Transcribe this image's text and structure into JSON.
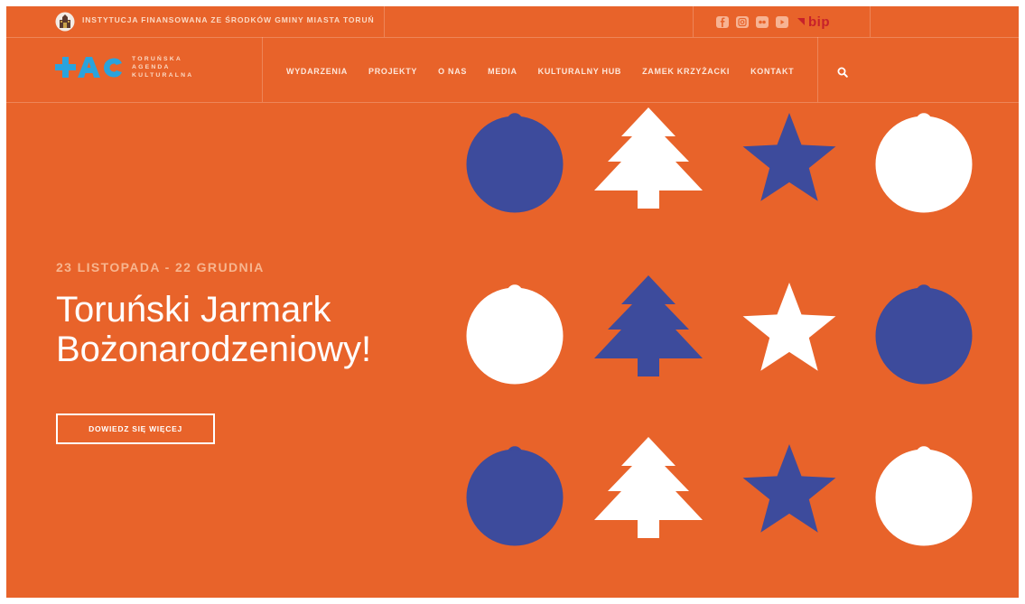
{
  "topbar": {
    "funding_text": "INSTYTUCJA FINANSOWANA ZE ŚRODKÓW GMINY MIASTA TORUŃ",
    "social_icons": [
      "facebook-icon",
      "instagram-icon",
      "flickr-icon",
      "youtube-icon"
    ],
    "bip_label": "bip"
  },
  "logo": {
    "mark": "+AC",
    "lines": [
      "TORUŃSKA",
      "AGENDA",
      "KULTURALNA"
    ]
  },
  "nav": {
    "items": [
      "WYDARZENIA",
      "PROJEKTY",
      "O NAS",
      "MEDIA",
      "KULTURALNY HUB",
      "ZAMEK KRZYŻACKI",
      "KONTAKT"
    ],
    "search_icon": "search-icon"
  },
  "hero": {
    "date": "23 LISTOPADA - 22 GRUDNIA",
    "title_line1": "Toruński Jarmark",
    "title_line2": "Bożonarodzeniowy!",
    "cta_label": "DOWIEDZ SIĘ WIĘCEJ"
  },
  "colors": {
    "background": "#e8632a",
    "ornament_blue": "#3d4b9c",
    "ornament_white": "#ffffff",
    "bip_red": "#c7212a",
    "logo_blue": "#2aa3dd"
  },
  "ornaments": [
    [
      "bauble-blue",
      "tree-white",
      "star-blue",
      "bauble-white"
    ],
    [
      "bauble-white",
      "tree-blue",
      "star-white",
      "bauble-blue"
    ],
    [
      "bauble-blue",
      "tree-white",
      "star-blue",
      "bauble-white"
    ]
  ]
}
